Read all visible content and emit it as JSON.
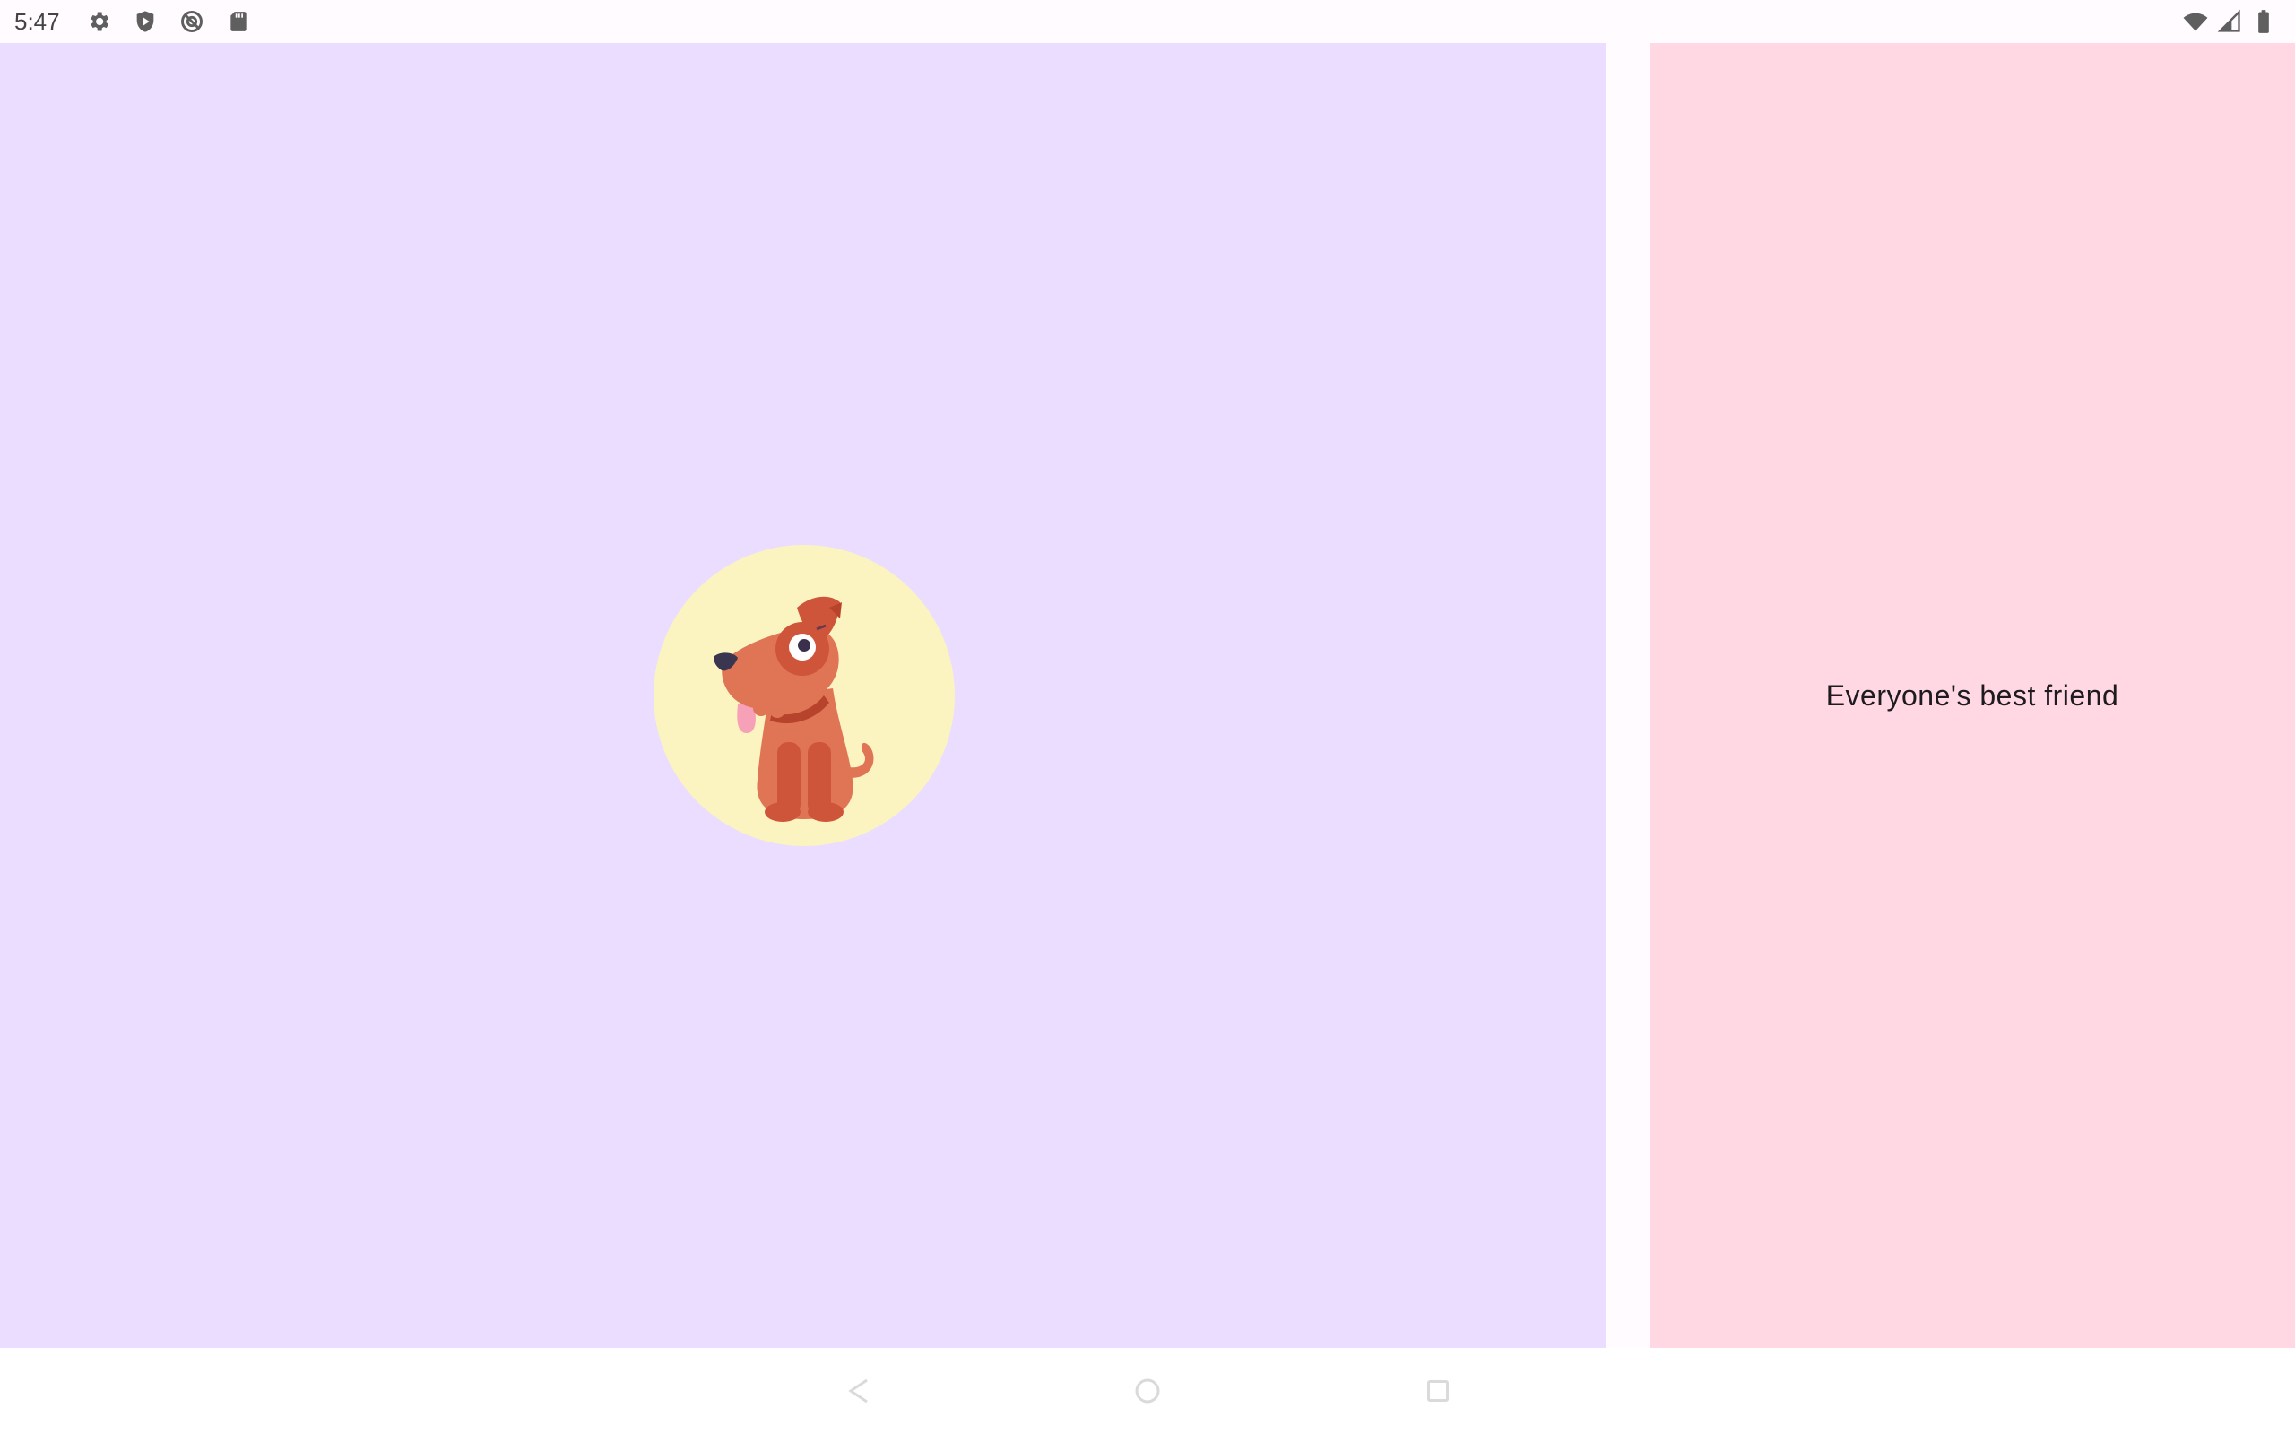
{
  "status_bar": {
    "time": "5:47",
    "left_icons": [
      "settings-icon",
      "shield-play-icon",
      "data-saver-icon",
      "sd-card-icon"
    ],
    "right_icons": [
      "wifi-icon",
      "cell-signal-icon",
      "battery-icon"
    ]
  },
  "detail": {
    "text": "Everyone's best friend"
  },
  "list": {
    "avatar": "dog-illustration"
  },
  "navigation": {
    "buttons": [
      "back",
      "home",
      "recents"
    ]
  },
  "colors": {
    "left_pane": "#eaddff",
    "right_pane": "#ffd8e4",
    "avatar_bg": "#fbf4c0",
    "dog_body": "#e07555",
    "dog_dark": "#cf553a"
  }
}
